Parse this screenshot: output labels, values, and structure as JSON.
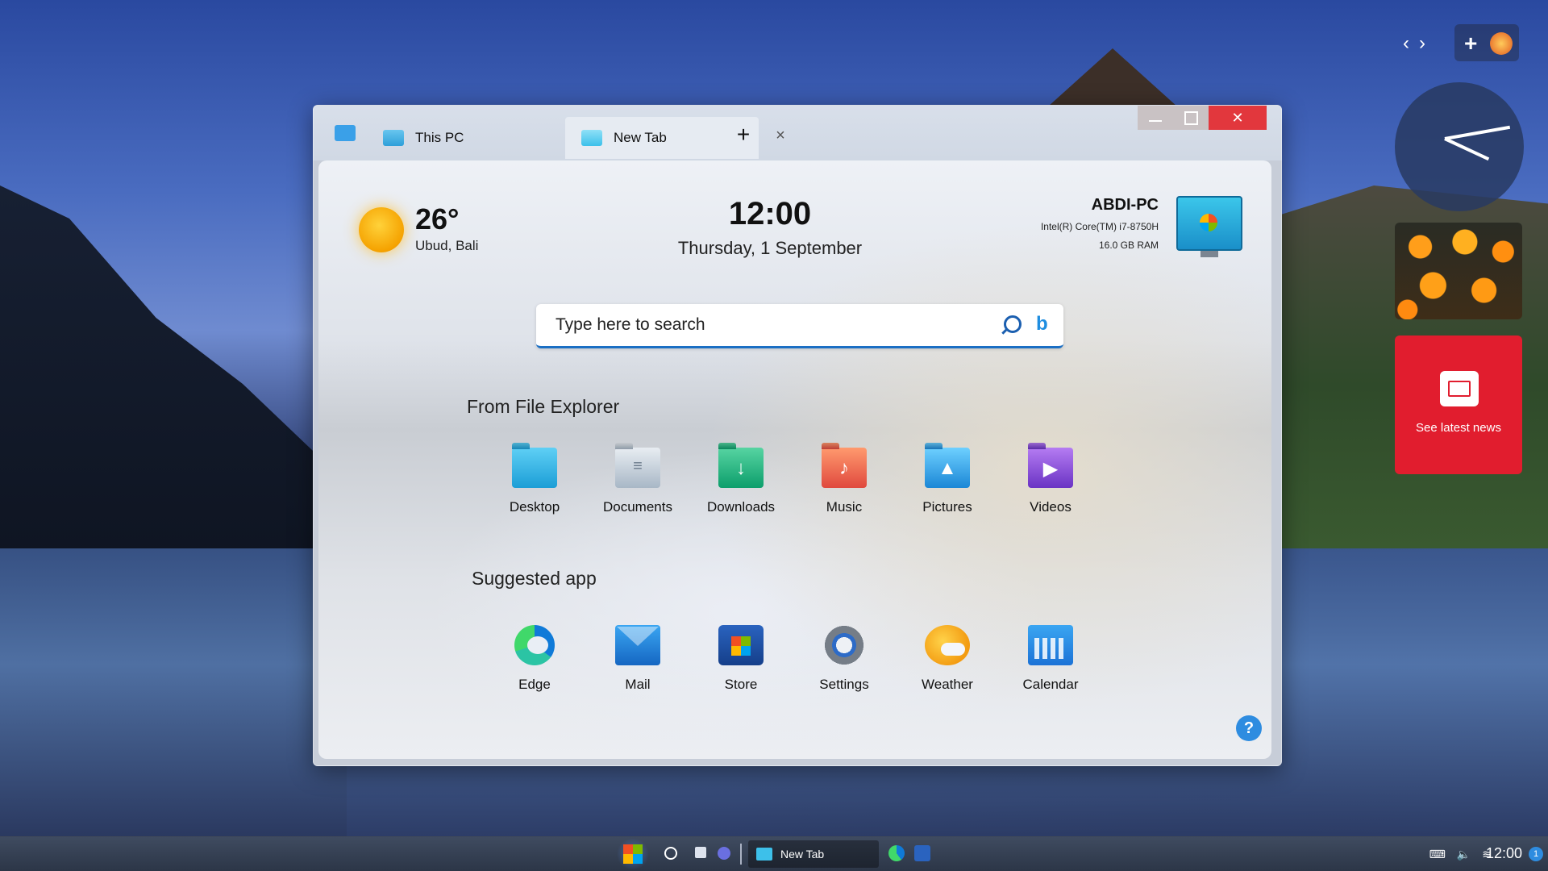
{
  "window": {
    "tabs": [
      {
        "label": "This PC"
      },
      {
        "label": "New Tab"
      }
    ],
    "add_tab": "+",
    "close_tab": "×"
  },
  "weather": {
    "temp": "26°",
    "location": "Ubud, Bali"
  },
  "clock": {
    "time": "12:00",
    "date": "Thursday, 1 September"
  },
  "pc": {
    "name": "ABDI-PC",
    "cpu": "Intel(R) Core(TM) i7-8750H",
    "ram": "16.0 GB RAM"
  },
  "search": {
    "placeholder": "Type here to search"
  },
  "file_explorer": {
    "title": "From File Explorer",
    "items": [
      {
        "label": "Desktop",
        "icon": "desktop-folder-icon"
      },
      {
        "label": "Documents",
        "icon": "documents-folder-icon"
      },
      {
        "label": "Downloads",
        "icon": "downloads-folder-icon"
      },
      {
        "label": "Music",
        "icon": "music-folder-icon"
      },
      {
        "label": "Pictures",
        "icon": "pictures-folder-icon"
      },
      {
        "label": "Videos",
        "icon": "videos-folder-icon"
      }
    ]
  },
  "suggested": {
    "title": "Suggested app",
    "items": [
      {
        "label": "Edge",
        "icon": "edge-icon"
      },
      {
        "label": "Mail",
        "icon": "mail-icon"
      },
      {
        "label": "Store",
        "icon": "store-icon"
      },
      {
        "label": "Settings",
        "icon": "settings-icon"
      },
      {
        "label": "Weather",
        "icon": "weather-icon"
      },
      {
        "label": "Calendar",
        "icon": "calendar-icon"
      }
    ]
  },
  "help": "?",
  "widgets": {
    "news": "See latest news"
  },
  "taskbar": {
    "window_label": "New Tab",
    "time": "12:00",
    "badge": "1"
  }
}
